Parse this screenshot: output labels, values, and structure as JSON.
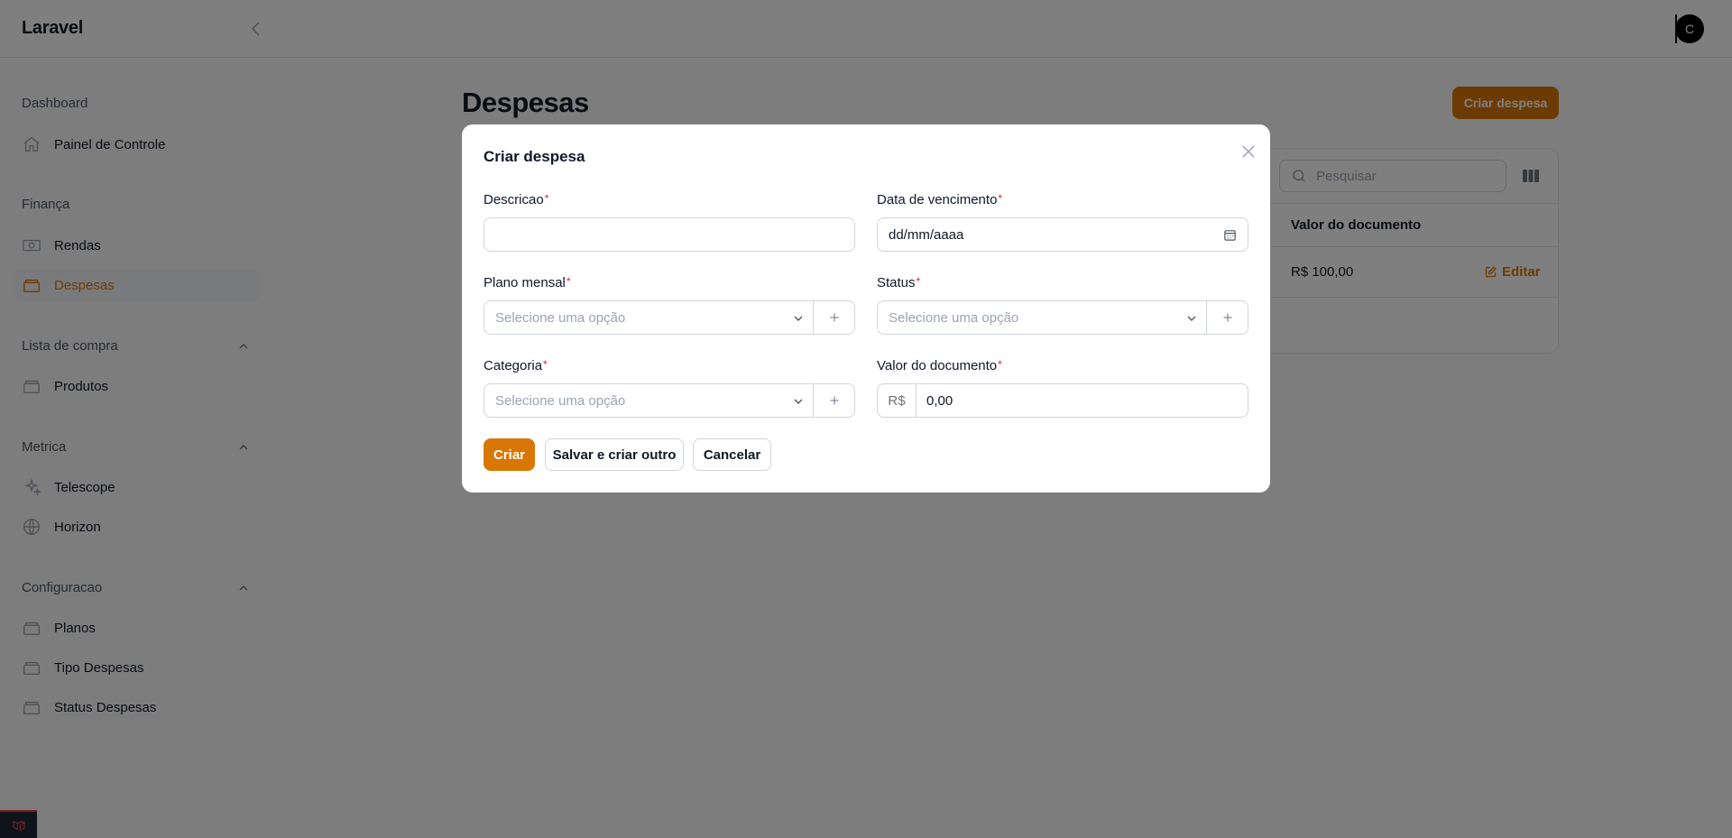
{
  "app": {
    "brand": "Laravel",
    "user_initial": "C"
  },
  "sidebar": {
    "groups": [
      {
        "label": "Dashboard",
        "items": [
          {
            "label": "Painel de Controle",
            "icon": "home-icon"
          }
        ]
      },
      {
        "label": "Finança",
        "items": [
          {
            "label": "Rendas",
            "icon": "cash-icon"
          },
          {
            "label": "Despesas",
            "icon": "box-icon",
            "active": true
          }
        ]
      },
      {
        "label": "Lista de compra",
        "items": [
          {
            "label": "Produtos",
            "icon": "box-icon"
          }
        ]
      },
      {
        "label": "Metrica",
        "items": [
          {
            "label": "Telescope",
            "icon": "sparkles-icon"
          },
          {
            "label": "Horizon",
            "icon": "globe-icon"
          }
        ]
      },
      {
        "label": "Configuracao",
        "items": [
          {
            "label": "Planos",
            "icon": "box-icon"
          },
          {
            "label": "Tipo Despesas",
            "icon": "box-icon"
          },
          {
            "label": "Status Despesas",
            "icon": "box-icon"
          }
        ]
      }
    ]
  },
  "page": {
    "title": "Despesas",
    "create_button": "Criar despesa",
    "search_placeholder": "Pesquisar",
    "table": {
      "visible_header": "Valor do documento",
      "rows": [
        {
          "valor": "R$ 100,00",
          "action": "Editar"
        }
      ]
    }
  },
  "modal": {
    "title": "Criar despesa",
    "fields": {
      "descricao": {
        "label": "Descricao",
        "value": ""
      },
      "data_vencimento": {
        "label": "Data de vencimento",
        "placeholder": "dd/mm/aaaa"
      },
      "plano_mensal": {
        "label": "Plano mensal",
        "placeholder": "Selecione uma opção"
      },
      "status": {
        "label": "Status",
        "placeholder": "Selecione uma opção"
      },
      "categoria": {
        "label": "Categoria",
        "placeholder": "Selecione uma opção"
      },
      "valor_documento": {
        "label": "Valor do documento",
        "prefix": "R$",
        "value": "0,00"
      }
    },
    "required_marker": "*",
    "buttons": {
      "create": "Criar",
      "save_and_new": "Salvar e criar outro",
      "cancel": "Cancelar"
    }
  },
  "colors": {
    "accent": "#d97706",
    "required": "#dc2626"
  }
}
